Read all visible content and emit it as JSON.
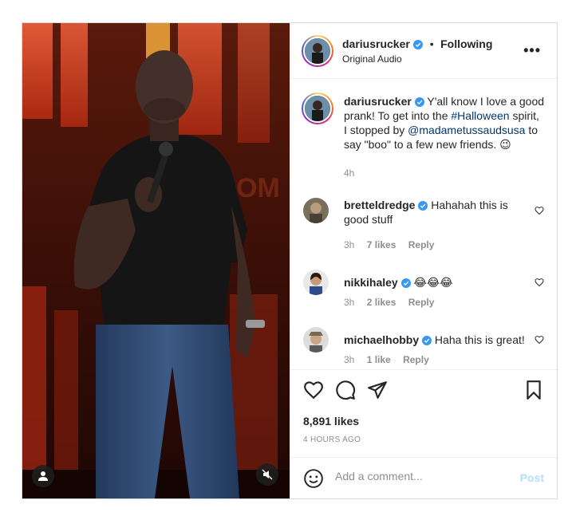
{
  "post": {
    "username": "dariusrucker",
    "follow_separator": "•",
    "follow_status": "Following",
    "audio": "Original Audio",
    "more_label": "•••"
  },
  "caption": {
    "username": "dariusrucker",
    "text_1": "Y'all know I love a good prank! To get into the ",
    "hashtag": "#Halloween",
    "text_2": " spirit, I stopped by ",
    "mention": "@madametussaudsusa",
    "text_3": " to say \"boo\" to a few new friends. ",
    "emoji": "😉",
    "time": "4h"
  },
  "comments": [
    {
      "username": "bretteldredge",
      "text": "Hahahah this is good stuff",
      "time": "3h",
      "likes": "7 likes",
      "reply": "Reply"
    },
    {
      "username": "nikkihaley",
      "text": "😂😂😂",
      "time": "3h",
      "likes": "2 likes",
      "reply": "Reply"
    },
    {
      "username": "michaelhobby",
      "text": "Haha this is great!",
      "time": "3h",
      "likes": "1 like",
      "reply": "Reply"
    }
  ],
  "stats": {
    "likes": "8,891 likes",
    "posted": "4 HOURS AGO"
  },
  "add_comment": {
    "placeholder": "Add a comment...",
    "post_label": "Post"
  },
  "colors": {
    "verified": "#3897f0",
    "link": "#00376b",
    "post_disabled": "#b2dffc"
  },
  "icons": [
    "heart-icon",
    "comment-icon",
    "share-icon",
    "bookmark-icon",
    "emoji-icon",
    "verified-icon",
    "user-tag-icon",
    "mute-icon"
  ]
}
